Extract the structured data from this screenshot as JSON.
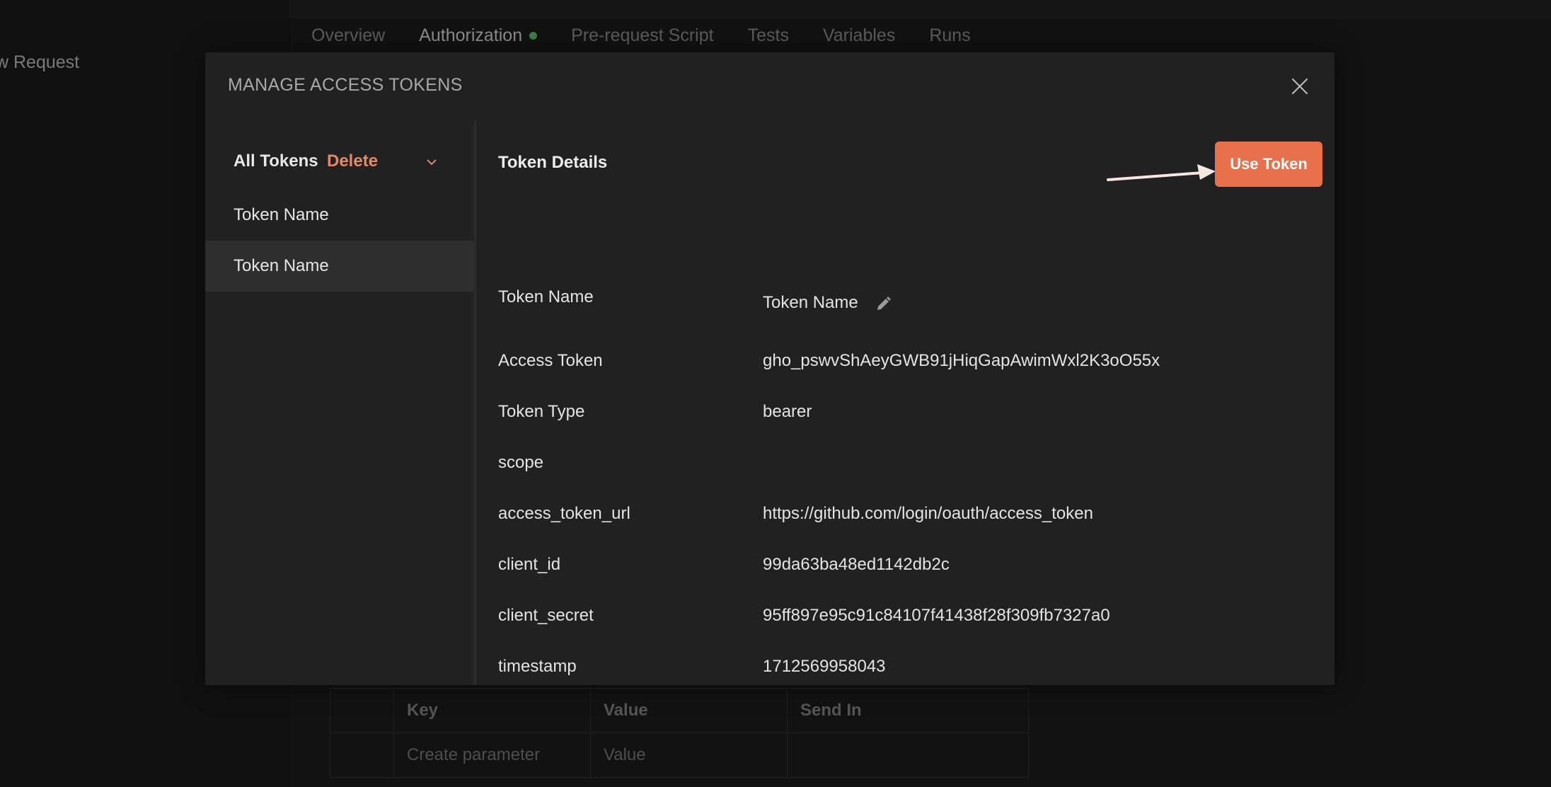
{
  "background": {
    "left_label": "w Request",
    "tabs": [
      {
        "label": "Overview"
      },
      {
        "label": "Authorization",
        "active": true
      },
      {
        "label": "Pre-request Script"
      },
      {
        "label": "Tests"
      },
      {
        "label": "Variables"
      },
      {
        "label": "Runs"
      }
    ],
    "table": {
      "headers": [
        "Key",
        "Value",
        "Send In"
      ],
      "row": {
        "key_placeholder": "Create parameter",
        "value_placeholder": "Value"
      }
    }
  },
  "modal": {
    "title": "MANAGE ACCESS TOKENS",
    "sidebar": {
      "all_label": "All Tokens",
      "delete_label": "Delete",
      "items": [
        {
          "label": "Token Name"
        },
        {
          "label": "Token Name",
          "selected": true
        }
      ]
    },
    "details": {
      "title": "Token Details",
      "use_token_label": "Use Token",
      "fields": [
        {
          "key": "Token Name",
          "value": "Token Name"
        },
        {
          "key": "Access Token",
          "value": "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"
        },
        {
          "key": "Token Type",
          "value": "bearer"
        },
        {
          "key": "scope",
          "value": ""
        },
        {
          "key": "access_token_url",
          "value": "https://github.com/login/oauth/access_token"
        },
        {
          "key": "client_id",
          "value": "99da63ba48ed1142db2c"
        },
        {
          "key": "client_secret",
          "value": "95ff897e95c91c84107f41438f28f309fb7327a0"
        },
        {
          "key": "timestamp",
          "value": "1712569958043"
        }
      ]
    }
  },
  "colors": {
    "accent": "#e8704a",
    "delete": "#e58867",
    "status_dot": "#3c7d47"
  }
}
